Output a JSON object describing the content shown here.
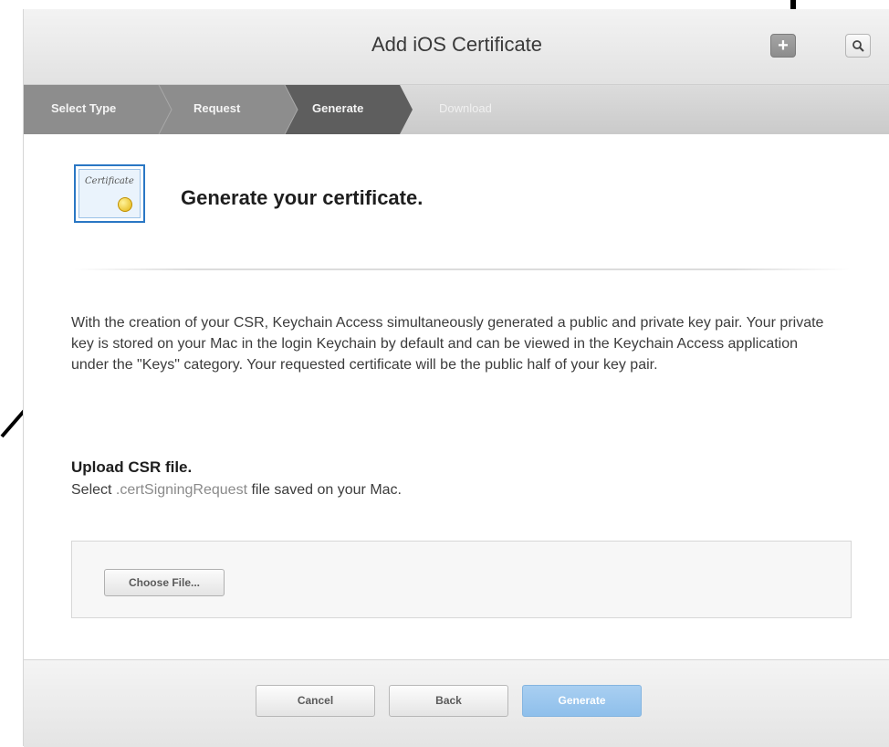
{
  "window": {
    "title": "Add iOS Certificate"
  },
  "toolbar": {
    "add_icon": "plus-icon",
    "search_icon": "search-icon",
    "add_glyph": "+"
  },
  "steps": [
    {
      "label": "Select Type",
      "state": "done"
    },
    {
      "label": "Request",
      "state": "done"
    },
    {
      "label": "Generate",
      "state": "current"
    },
    {
      "label": "Download",
      "state": "pending"
    }
  ],
  "content": {
    "cert_icon_text": "Certificate",
    "heading": "Generate your certificate.",
    "body": "With the creation of your CSR, Keychain Access simultaneously generated a public and private key pair. Your private key is stored on your Mac in the login Keychain by default and can be viewed in the Keychain Access application under the \"Keys\" category. Your requested certificate will be the public half of your key pair.",
    "upload_title": "Upload CSR file.",
    "upload_desc_prefix": "Select ",
    "upload_desc_ext": ".certSigningRequest",
    "upload_desc_suffix": " file saved on your Mac.",
    "choose_file_label": "Choose File..."
  },
  "footer": {
    "cancel_label": "Cancel",
    "back_label": "Back",
    "generate_label": "Generate"
  },
  "colors": {
    "step_done": "#8c8c8c",
    "step_current": "#5c5c5c",
    "step_pending": "#c9c9c9",
    "generate_button": "#9cc7ee",
    "cert_border": "#2a77c4"
  }
}
